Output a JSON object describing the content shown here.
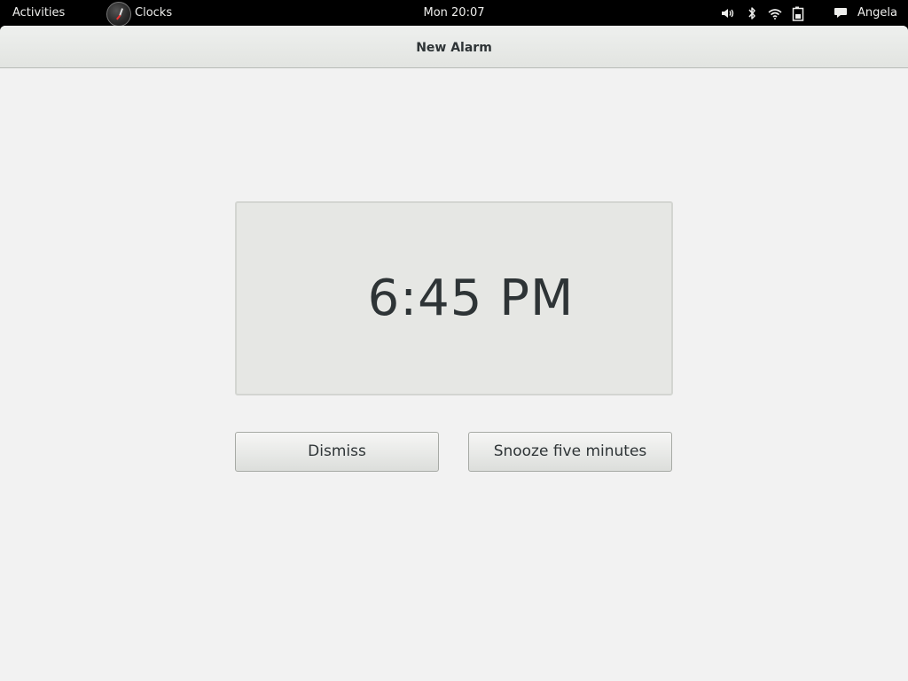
{
  "topbar": {
    "activities_label": "Activities",
    "app_name": "Clocks",
    "app_icon": "clocks-app-icon",
    "clock_text": "Mon 20:07",
    "tray_icons": [
      "volume-icon",
      "bluetooth-icon",
      "wifi-icon",
      "battery-icon",
      "chat-icon"
    ],
    "user_name": "Angela"
  },
  "window": {
    "title": "New Alarm"
  },
  "alarm": {
    "time": "6:45 PM",
    "dismiss_label": "Dismiss",
    "snooze_label": "Snooze five minutes"
  },
  "colors": {
    "topbar_bg": "#000000",
    "window_bg": "#f2f2f2",
    "time_box_bg": "#e6e7e4",
    "text": "#2e3436"
  }
}
